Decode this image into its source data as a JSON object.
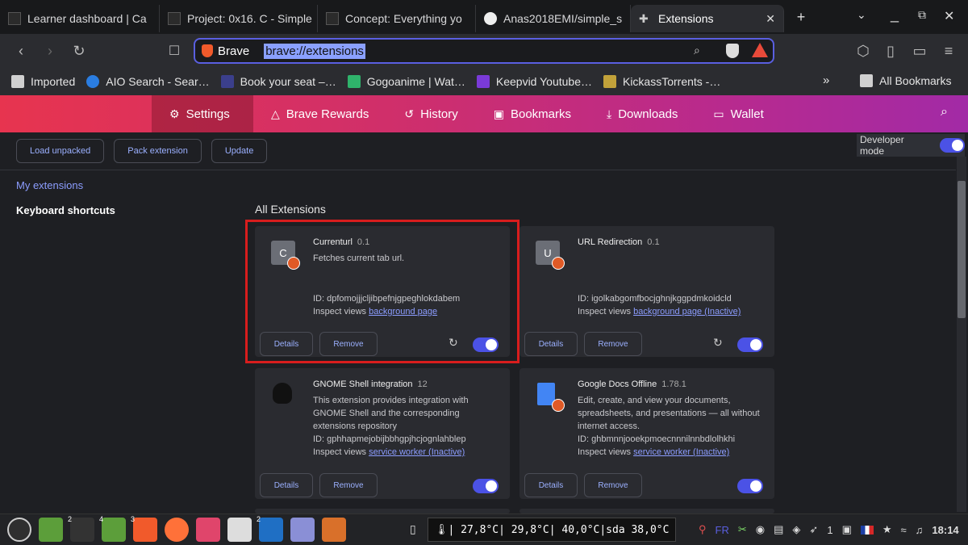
{
  "tabs": [
    {
      "title": "Learner dashboard | Ca",
      "active": false
    },
    {
      "title": "Project: 0x16. C - Simple",
      "active": false
    },
    {
      "title": "Concept: Everything yo",
      "active": false
    },
    {
      "title": "Anas2018EMI/simple_s",
      "active": false
    },
    {
      "title": "Extensions",
      "active": true
    }
  ],
  "new_tab": "+",
  "address": {
    "site": "Brave",
    "url": "brave://extensions"
  },
  "bookmarks": [
    {
      "label": "Imported",
      "color": "#d0d0d0"
    },
    {
      "label": "AIO Search - Sear…",
      "color": "#2a7de1"
    },
    {
      "label": "Book your seat –…",
      "color": "#3b3f8c"
    },
    {
      "label": "Gogoanime | Wat…",
      "color": "#2fb36b"
    },
    {
      "label": "Keepvid Youtube…",
      "color": "#7a3ad8"
    },
    {
      "label": "KickassTorrents -…",
      "color": "#c2a23a"
    }
  ],
  "bookmarks_more": "»",
  "all_bookmarks": "All Bookmarks",
  "pagetabs": [
    {
      "label": "Settings",
      "icon": "⚙"
    },
    {
      "label": "Brave Rewards",
      "icon": "△"
    },
    {
      "label": "History",
      "icon": "↺"
    },
    {
      "label": "Bookmarks",
      "icon": "▣"
    },
    {
      "label": "Downloads",
      "icon": "⤓"
    },
    {
      "label": "Wallet",
      "icon": "▭"
    }
  ],
  "toolbar": {
    "load_unpacked": "Load unpacked",
    "pack_extension": "Pack extension",
    "update": "Update",
    "developer_mode": "Developer mode"
  },
  "sidenav": {
    "my_extensions": "My extensions",
    "keyboard_shortcuts": "Keyboard shortcuts"
  },
  "section_title": "All Extensions",
  "extensions": [
    {
      "letter": "C",
      "name": "Currenturl",
      "version": "0.1",
      "desc": "Fetches current tab url.",
      "id": "ID: dpfomojjjcljibpefnjgpeghlokdabem",
      "inspect_prefix": "Inspect views ",
      "inspect_link": "background page",
      "details": "Details",
      "remove": "Remove",
      "reload": "↻"
    },
    {
      "letter": "U",
      "name": "URL Redirection",
      "version": "0.1",
      "desc": "",
      "id": "ID: igolkabgomfbocjghnjkggpdmkoidcld",
      "inspect_prefix": "Inspect views ",
      "inspect_link": "background page (Inactive)",
      "details": "Details",
      "remove": "Remove",
      "reload": "↻"
    },
    {
      "letter": "",
      "name": "GNOME Shell integration",
      "version": "12",
      "desc": "This extension provides integration with GNOME Shell and the corresponding extensions repository",
      "id": "ID: gphhapmejobijbbhgpjhcjognlahblep",
      "inspect_prefix": "Inspect views ",
      "inspect_link": "service worker (Inactive)",
      "details": "Details",
      "remove": "Remove"
    },
    {
      "letter": "",
      "name": "Google Docs Offline",
      "version": "1.78.1",
      "desc": "Edit, create, and view your documents, spreadsheets, and presentations — all without internet access.",
      "id": "ID: ghbmnnjooekpmoecnnnilnnbdlolhkhi",
      "inspect_prefix": "Inspect views ",
      "inspect_link": "service worker (Inactive)",
      "details": "Details",
      "remove": "Remove"
    }
  ],
  "taskbar": {
    "sysmon": "🌡| 27,8°C| 29,8°C| 40,0°C|sda 38,0°C",
    "lang": "FR",
    "workspace_count": "1",
    "clock": "18:14",
    "workspaces": [
      "2",
      "4",
      "3",
      "2"
    ]
  }
}
